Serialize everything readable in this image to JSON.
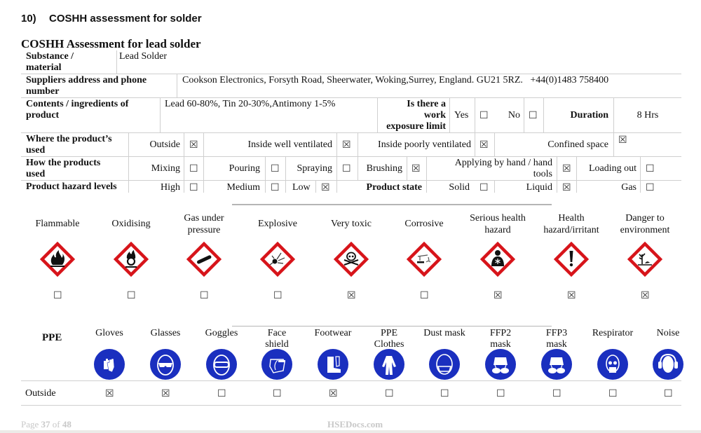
{
  "section": {
    "number": "10)",
    "title": "COSHH assessment for solder"
  },
  "document_title": "COSHH Assessment for lead solder",
  "substance": {
    "label": "Substance / material",
    "label_line1": "Substance /",
    "label_line2": "material",
    "value": "Lead Solder"
  },
  "supplier": {
    "label_line1": "Suppliers address and phone",
    "label_line2": "number",
    "value": "Cookson Electronics, Forsyth Road, Sheerwater, Woking,Surrey, England. GU21 5RZ.   +44(0)1483 758400"
  },
  "contents": {
    "label_line1": "Contents / ingredients of",
    "label_line2": "product",
    "value": "Lead 60-80%, Tin 20-30%,Antimony 1-5%",
    "exposure_label_line1": "Is there a",
    "exposure_label_line2": "work",
    "exposure_label_line3": "exposure limit",
    "yes_label": "Yes",
    "yes_checked": "☐",
    "no_label": "No",
    "no_checked": "☐",
    "duration_label": "Duration",
    "duration_value": "8 Hrs"
  },
  "where_used": {
    "label_line1": "Where the product’s",
    "label_line2": "used",
    "options": [
      {
        "label": "Outside",
        "mark": "☒"
      },
      {
        "label": "Inside well ventilated",
        "mark": "☒"
      },
      {
        "label": "Inside poorly ventilated",
        "mark": "☒"
      },
      {
        "label": "Confined space",
        "mark": "☒"
      }
    ]
  },
  "how_used": {
    "label_line1": "How the products",
    "label_line2": "used",
    "options": [
      {
        "label": "Mixing",
        "mark": "☐"
      },
      {
        "label": "Pouring",
        "mark": "☐"
      },
      {
        "label": "Spraying",
        "mark": "☐"
      },
      {
        "label": "Brushing",
        "mark": "☒"
      },
      {
        "label_line1": "Applying by hand / hand",
        "label_line2": "tools",
        "mark": "☒"
      },
      {
        "label": "Loading out",
        "mark": "☐"
      }
    ]
  },
  "hazard_levels": {
    "label": "Product hazard levels",
    "options": [
      {
        "label": "High",
        "mark": "☐"
      },
      {
        "label": "Medium",
        "mark": "☐"
      },
      {
        "label": "Low",
        "mark": "☒"
      }
    ],
    "state_label": "Product state",
    "states": [
      {
        "label": "Solid",
        "mark": "☐"
      },
      {
        "label": "Liquid",
        "mark": "☒"
      },
      {
        "label": "Gas",
        "mark": "☐"
      }
    ]
  },
  "hazards": [
    {
      "line1": "Flammable",
      "line2": "",
      "icon": "flame-icon",
      "mark": "☐"
    },
    {
      "line1": "Oxidising",
      "line2": "",
      "icon": "flame-over-circle-icon",
      "mark": "☐"
    },
    {
      "line1": "Gas under",
      "line2": "pressure",
      "icon": "gas-cylinder-icon",
      "mark": "☐"
    },
    {
      "line1": "Explosive",
      "line2": "",
      "icon": "exploding-bomb-icon",
      "mark": "☐"
    },
    {
      "line1": "Very toxic",
      "line2": "",
      "icon": "skull-crossbones-icon",
      "mark": "☒"
    },
    {
      "line1": "Corrosive",
      "line2": "",
      "icon": "corrosion-icon",
      "mark": "☐"
    },
    {
      "line1": "Serious health",
      "line2": "hazard",
      "icon": "health-hazard-icon",
      "mark": "☒"
    },
    {
      "line1": "Health",
      "line2": "hazard/irritant",
      "icon": "exclamation-mark-icon",
      "mark": "☒"
    },
    {
      "line1": "Danger to",
      "line2": "environment",
      "icon": "environment-icon",
      "mark": "☒"
    }
  ],
  "ppe": {
    "label": "PPE",
    "row_label": "Outside",
    "items": [
      {
        "line1": "Gloves",
        "line2": "",
        "icon": "gloves-icon",
        "mark": "☒"
      },
      {
        "line1": "Glasses",
        "line2": "",
        "icon": "safety-glasses-icon",
        "mark": "☒"
      },
      {
        "line1": "Goggles",
        "line2": "",
        "icon": "goggles-icon",
        "mark": "☐"
      },
      {
        "line1": "Face",
        "line2": "shield",
        "icon": "face-shield-icon",
        "mark": "☐"
      },
      {
        "line1": "Footwear",
        "line2": "",
        "icon": "safety-boots-icon",
        "mark": "☒"
      },
      {
        "line1": "PPE",
        "line2": "Clothes",
        "icon": "coverall-icon",
        "mark": "☐"
      },
      {
        "line1": "Dust mask",
        "line2": "",
        "icon": "dust-mask-icon",
        "mark": "☐"
      },
      {
        "line1": "FFP2",
        "line2": "mask",
        "icon": "ffp2-mask-icon",
        "mark": "☐"
      },
      {
        "line1": "FFP3",
        "line2": "mask",
        "icon": "ffp3-mask-icon",
        "mark": "☐"
      },
      {
        "line1": "Respirator",
        "line2": "",
        "icon": "respirator-icon",
        "mark": "☐"
      },
      {
        "line1": "Noise",
        "line2": "",
        "icon": "ear-defenders-icon",
        "mark": "☐"
      }
    ]
  },
  "footer": {
    "page_prefix": "Page ",
    "page_current": "37",
    "page_of": " of ",
    "page_total": "48",
    "site": "HSEDocs.com"
  },
  "colors": {
    "ghs_red": "#d7141a",
    "ppe_blue": "#1a2fbf",
    "rule_grey": "#cfcfcf"
  }
}
